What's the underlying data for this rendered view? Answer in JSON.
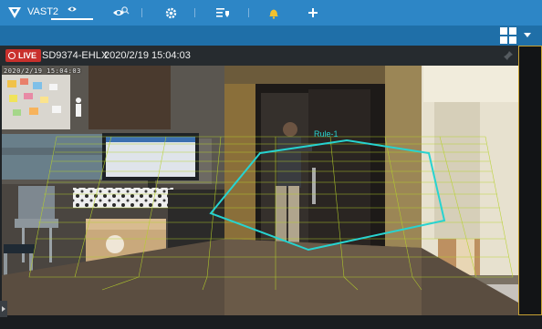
{
  "app": {
    "title": "VAST2"
  },
  "toolbar": {
    "icons": [
      "eye-icon",
      "gear-icon",
      "event-list-icon",
      "bell-icon",
      "plus-icon"
    ]
  },
  "tabs": [
    {
      "icon": "eye-icon",
      "active": true
    },
    {
      "icon": "search-icon",
      "active": false
    }
  ],
  "view": {
    "live_label": "LIVE",
    "camera_name": "SD9374-EHLX",
    "datetime": "2020/2/19 15:04:03",
    "overlay_timestamp": "2020/2/19 15:04:03",
    "rule_label": "Rule-1"
  },
  "colors": {
    "topbar": "#2d86c6",
    "tabbar": "#1f6fa8",
    "live": "#c9302c",
    "rule": "#27d3d0",
    "grid": "#b6d12a",
    "side_border": "#c8a234"
  }
}
